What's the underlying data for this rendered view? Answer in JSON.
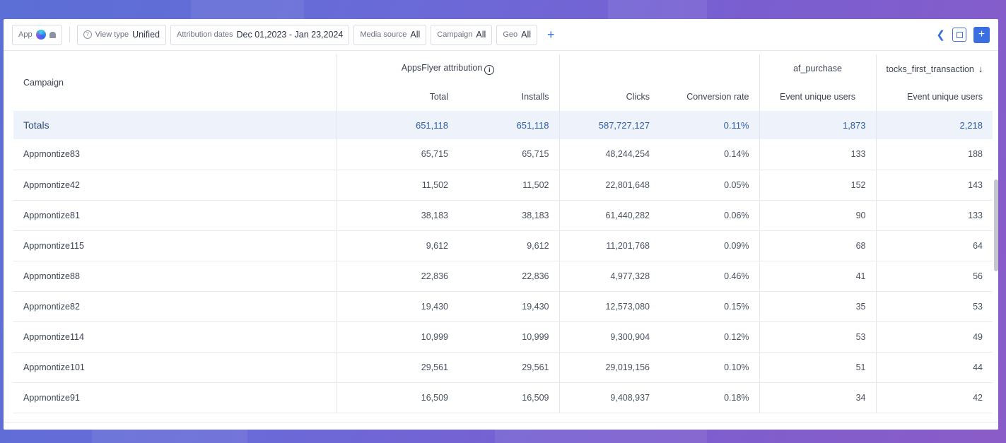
{
  "toolbar": {
    "app_label": "App",
    "view_type_label": "View type",
    "view_type_value": "Unified",
    "attribution_label": "Attribution dates",
    "attribution_value": "Dec 01,2023 - Jan 23,2024",
    "media_source_label": "Media source",
    "media_source_value": "All",
    "campaign_label": "Campaign",
    "campaign_value": "All",
    "geo_label": "Geo",
    "geo_value": "All",
    "add_filter": "+",
    "add_button": "+"
  },
  "table": {
    "group_headers": {
      "attribution": "AppsFlyer attribution",
      "purchase": "af_purchase",
      "stocks": "tocks_first_transaction"
    },
    "columns": {
      "campaign": "Campaign",
      "total": "Total",
      "installs": "Installs",
      "clicks": "Clicks",
      "conversion": "Conversion rate",
      "purchase_users": "Event unique users",
      "stocks_users": "Event unique users"
    },
    "totals": {
      "label": "Totals",
      "total": "651,118",
      "installs": "651,118",
      "clicks": "587,727,127",
      "conversion": "0.11%",
      "purchase_users": "1,873",
      "stocks_users": "2,218"
    },
    "rows": [
      {
        "campaign": "Appmontize83",
        "total": "65,715",
        "installs": "65,715",
        "clicks": "48,244,254",
        "conversion": "0.14%",
        "purchase_users": "133",
        "stocks_users": "188"
      },
      {
        "campaign": "Appmontize42",
        "total": "11,502",
        "installs": "11,502",
        "clicks": "22,801,648",
        "conversion": "0.05%",
        "purchase_users": "152",
        "stocks_users": "143"
      },
      {
        "campaign": "Appmontize81",
        "total": "38,183",
        "installs": "38,183",
        "clicks": "61,440,282",
        "conversion": "0.06%",
        "purchase_users": "90",
        "stocks_users": "133"
      },
      {
        "campaign": "Appmontize115",
        "total": "9,612",
        "installs": "9,612",
        "clicks": "11,201,768",
        "conversion": "0.09%",
        "purchase_users": "68",
        "stocks_users": "64"
      },
      {
        "campaign": "Appmontize88",
        "total": "22,836",
        "installs": "22,836",
        "clicks": "4,977,328",
        "conversion": "0.46%",
        "purchase_users": "41",
        "stocks_users": "56"
      },
      {
        "campaign": "Appmontize82",
        "total": "19,430",
        "installs": "19,430",
        "clicks": "12,573,080",
        "conversion": "0.15%",
        "purchase_users": "35",
        "stocks_users": "53"
      },
      {
        "campaign": "Appmontize114",
        "total": "10,999",
        "installs": "10,999",
        "clicks": "9,300,904",
        "conversion": "0.12%",
        "purchase_users": "53",
        "stocks_users": "49"
      },
      {
        "campaign": "Appmontize101",
        "total": "29,561",
        "installs": "29,561",
        "clicks": "29,019,156",
        "conversion": "0.10%",
        "purchase_users": "51",
        "stocks_users": "44"
      },
      {
        "campaign": "Appmontize91",
        "total": "16,509",
        "installs": "16,509",
        "clicks": "9,408,937",
        "conversion": "0.18%",
        "purchase_users": "34",
        "stocks_users": "42"
      }
    ]
  },
  "colors": {
    "accent": "#3b6ee0",
    "totals_bg": "#eef3fb",
    "background": "#6a6ad8"
  },
  "icons": {
    "app": "app-logo-icon",
    "platform": "android-icon",
    "view_type": "question-circle-icon",
    "info": "info-circle-icon",
    "sort": "arrow-down-icon",
    "share": "share-icon",
    "save": "save-icon",
    "add": "plus-icon"
  }
}
